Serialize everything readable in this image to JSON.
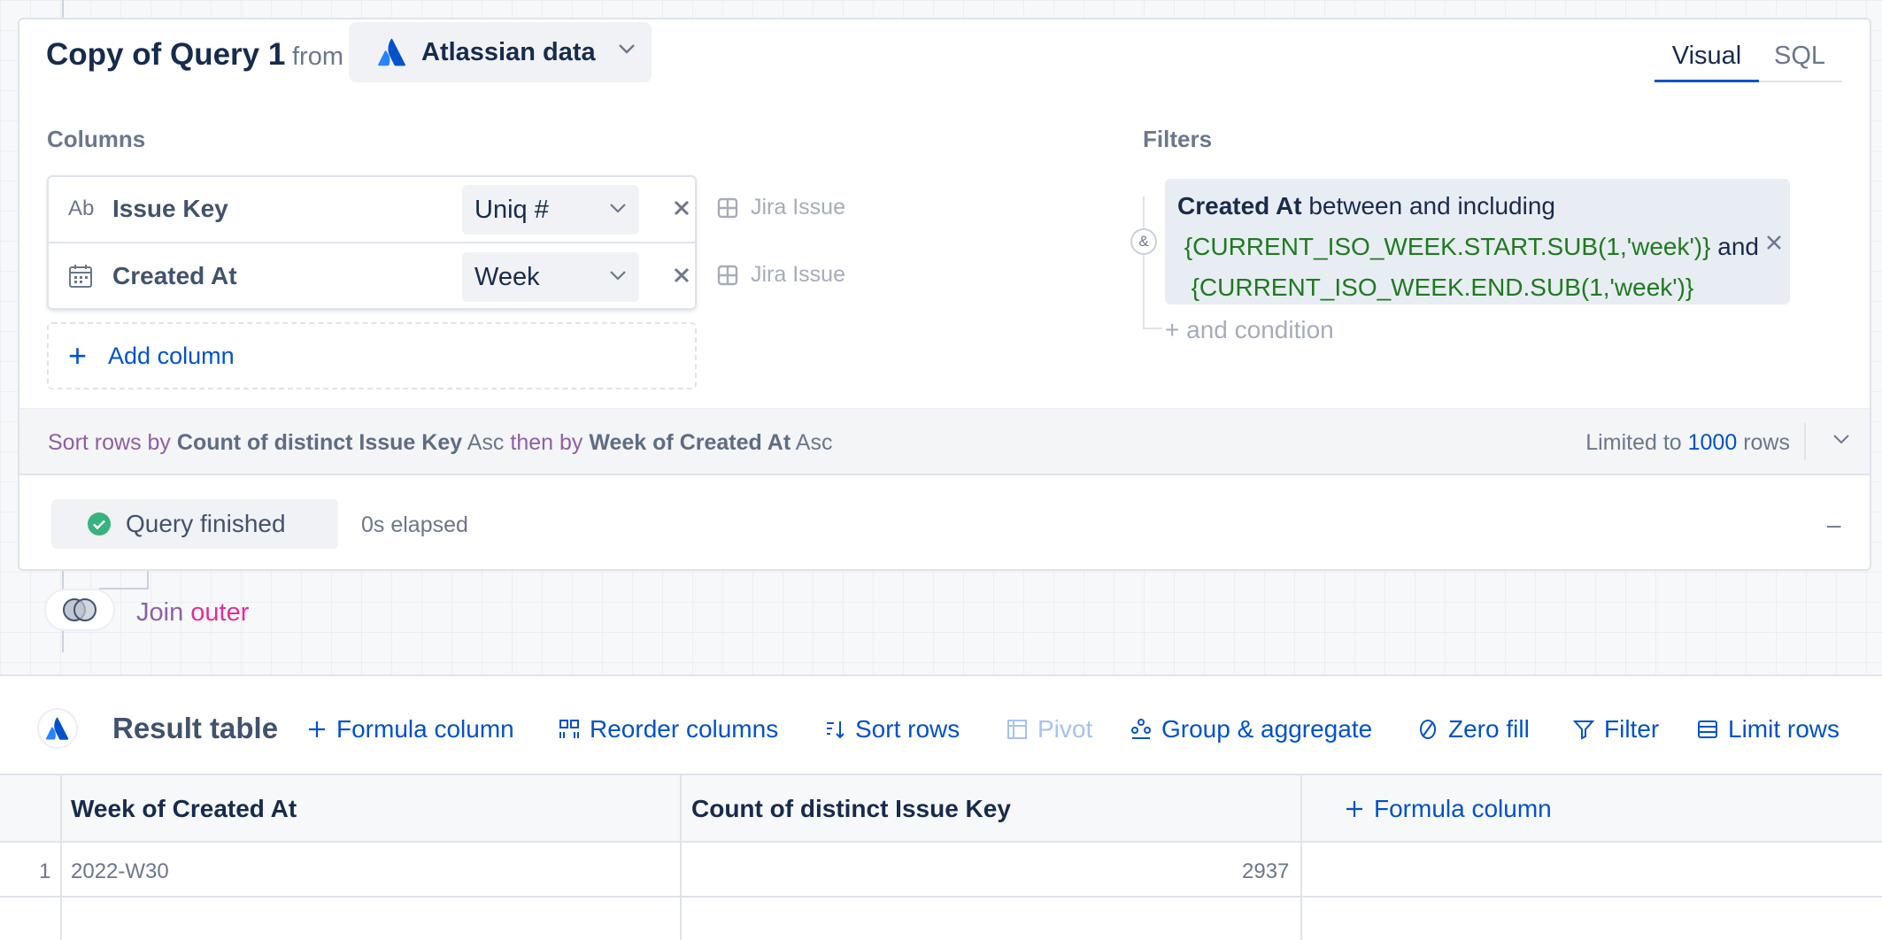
{
  "query": {
    "title": "Copy of Query 1",
    "from_label": "from",
    "source": "Atlassian data",
    "tabs": [
      {
        "label": "Visual",
        "active": true
      },
      {
        "label": "SQL",
        "active": false
      }
    ]
  },
  "columns": {
    "heading": "Columns",
    "items": [
      {
        "type_icon": "Ab",
        "name": "Issue Key",
        "aggregation": "Uniq #",
        "source": "Jira Issue"
      },
      {
        "type_icon": "calendar-icon",
        "name": "Created At",
        "aggregation": "Week",
        "source": "Jira Issue"
      }
    ],
    "add_label": "Add column"
  },
  "filters": {
    "heading": "Filters",
    "field": "Created At",
    "operator": "between and including",
    "start_expr": "{CURRENT_ISO_WEEK.START.SUB(1,'week')}",
    "joiner": "and",
    "end_expr": "{CURRENT_ISO_WEEK.END.SUB(1,'week')}",
    "combinator": "&",
    "and_condition": "+ and condition"
  },
  "sort": {
    "prefix": "Sort rows by",
    "first_col": "Count of distinct Issue Key",
    "first_dir": "Asc",
    "then_by": "then by",
    "second_col": "Week of Created At",
    "second_dir": "Asc",
    "limit_prefix": "Limited to",
    "limit_value": "1000",
    "limit_suffix": "rows"
  },
  "status": {
    "label": "Query finished",
    "elapsed": "0s elapsed",
    "collapse": "–",
    "color": "#36b37e"
  },
  "join": {
    "label": "Join",
    "type": "outer"
  },
  "result": {
    "title": "Result table",
    "toolbar": {
      "formula": "Formula column",
      "reorder": "Reorder columns",
      "sort": "Sort rows",
      "pivot": "Pivot",
      "group": "Group & aggregate",
      "zero_fill": "Zero fill",
      "filter": "Filter",
      "limit": "Limit rows"
    },
    "headers": {
      "col1": "Week of Created At",
      "col2": "Count of distinct Issue Key",
      "add_formula": "Formula column"
    },
    "rows": [
      {
        "num": "1",
        "week": "2022-W30",
        "count": "2937"
      }
    ]
  },
  "colors": {
    "accent": "#0052cc",
    "keyword_purple": "#8e5fa5",
    "join_pink": "#e0309a",
    "expr_green": "#1f7a1f"
  }
}
